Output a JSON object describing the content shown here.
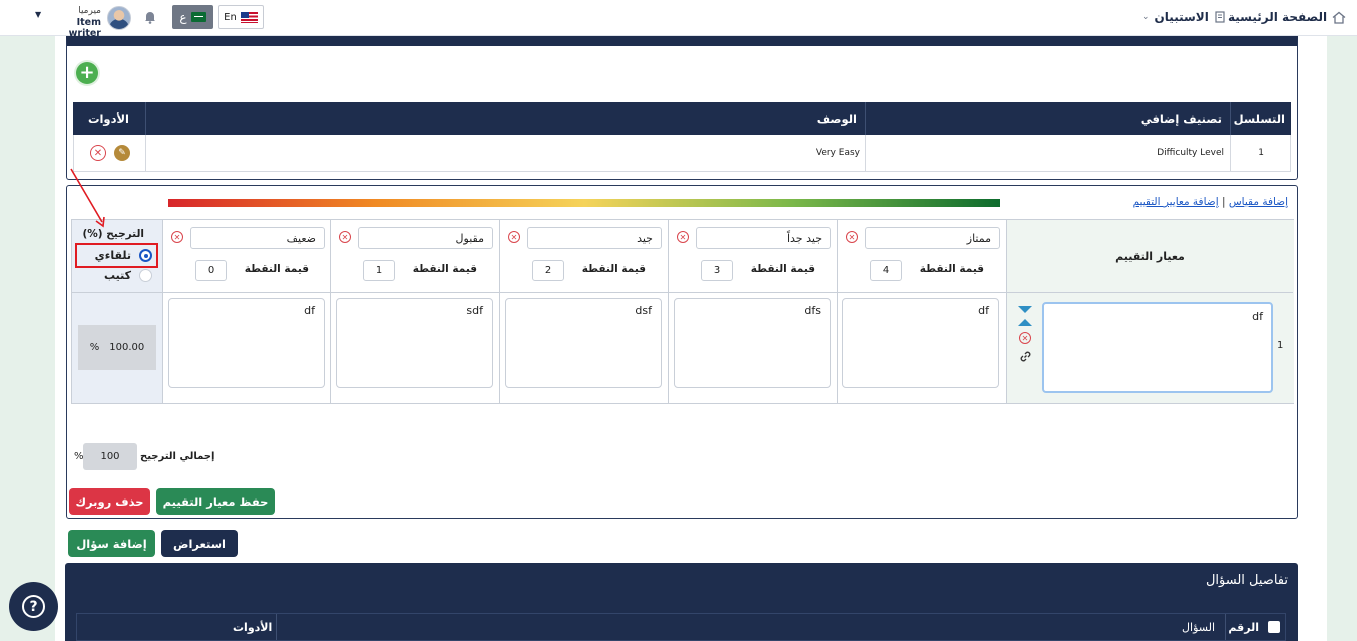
{
  "topbar": {
    "home_label": "الصفحة الرئيسية",
    "survey_label": "الاستبيان",
    "lang_ar": "ع",
    "lang_en": "En",
    "user_name": "ميرميا",
    "user_role": "Item writer"
  },
  "classification_table": {
    "headers": {
      "tools": "الأدوات",
      "description": "الوصف",
      "extra_class": "تصنيف إضافي",
      "serial": "التسلسل"
    },
    "rows": [
      {
        "serial": "1",
        "extra_class": "Difficulty Level",
        "description": "Very Easy"
      }
    ]
  },
  "rubric": {
    "links": {
      "add_criteria": "إضافة معايير التقييم",
      "separator": "|",
      "add_scale": "إضافة مقياس"
    },
    "weight_header": "(%) الترجيح",
    "weight_options": {
      "auto": "تلقاءي",
      "manual": "كتيب"
    },
    "criteria_header": "معيار التقييم",
    "points_label": "قيمة النقطة",
    "levels": [
      {
        "name": "ممتاز",
        "points": "4",
        "desc": "df"
      },
      {
        "name": "جيد جداً",
        "points": "3",
        "desc": "dfs"
      },
      {
        "name": "جيد",
        "points": "2",
        "desc": "dsf"
      },
      {
        "name": "مقبول",
        "points": "1",
        "desc": "sdf"
      },
      {
        "name": "ضعيف",
        "points": "0",
        "desc": "df"
      }
    ],
    "criteria_row": {
      "index": "1",
      "text": "df",
      "weight": "100.00",
      "weight_unit": "%"
    },
    "total_weight_label": "إجمالي الترجيح",
    "total_weight_value": "100",
    "total_weight_unit": "%"
  },
  "buttons": {
    "save_rubric": "حفظ معيار التقييم",
    "delete_rubric": "حذف روبرك",
    "preview": "استعراض",
    "add_question": "إضافة سؤال"
  },
  "question_details": {
    "title": "تفاصيل السؤال",
    "headers": {
      "number": "الرقم",
      "question": "السؤال",
      "tools": "الأدوات"
    }
  }
}
